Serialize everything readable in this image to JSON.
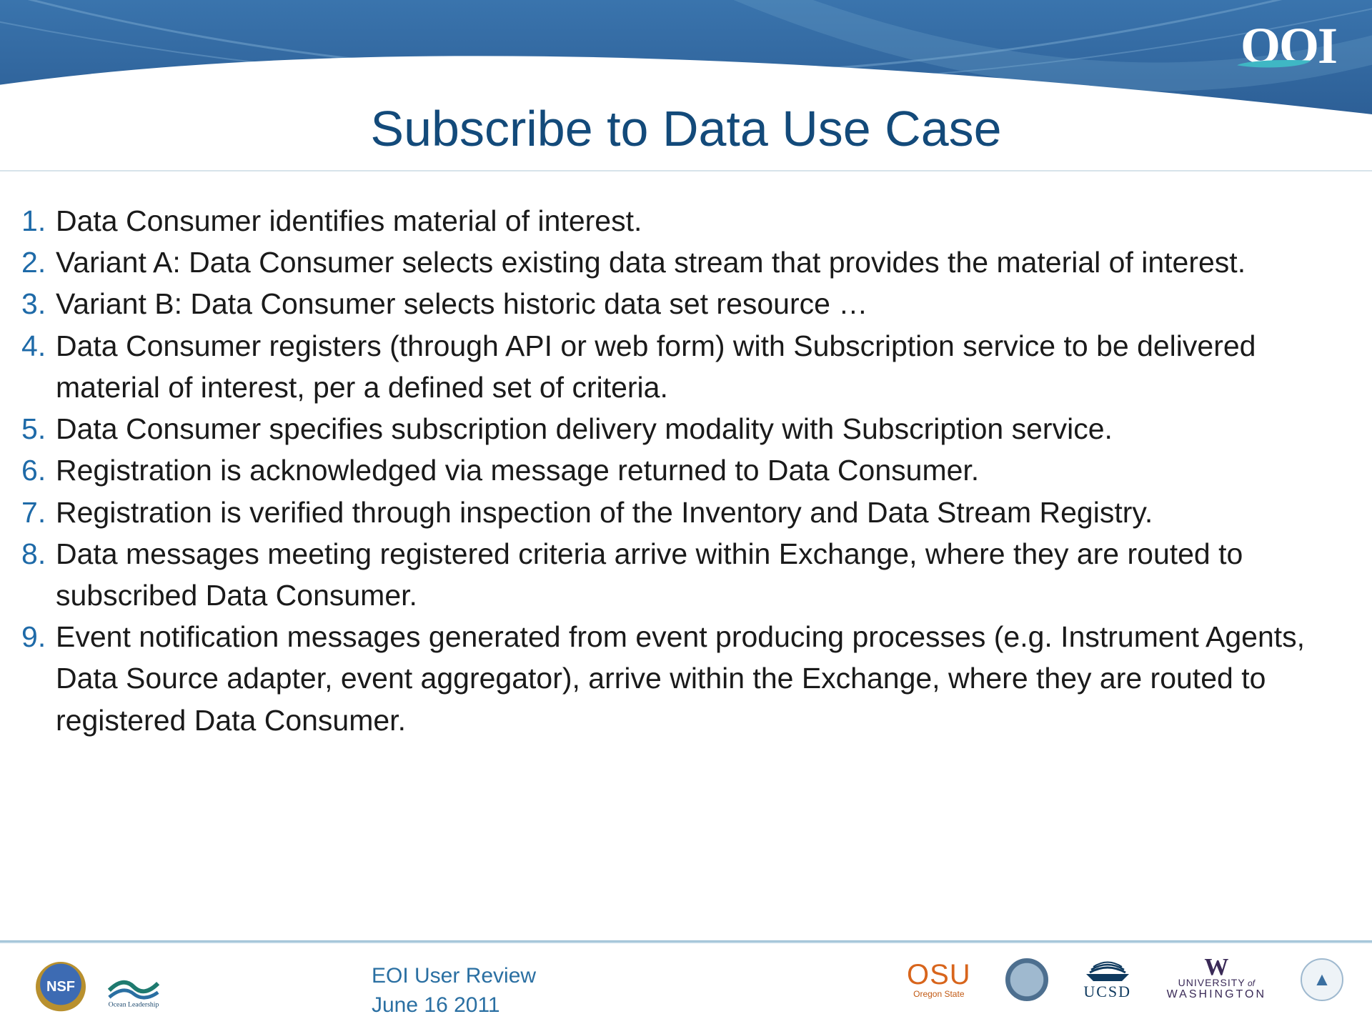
{
  "header": {
    "logo_text": "OOI"
  },
  "title": "Subscribe to Data Use Case",
  "steps": [
    "Data Consumer identifies material of interest.",
    "Variant A: Data Consumer selects existing data stream that provides the material of interest.",
    "Variant B: Data Consumer selects historic data set resource …",
    "Data Consumer registers (through API or web form) with Subscription service to be delivered material of interest, per a defined set of criteria.",
    "Data Consumer specifies subscription delivery modality with Subscription service.",
    "Registration is acknowledged via message returned to Data Consumer.",
    "Registration is verified through inspection of the Inventory and Data Stream Registry.",
    "Data messages meeting registered criteria arrive within Exchange, where they are routed to subscribed Data Consumer.",
    "Event notification messages generated from event producing processes (e.g. Instrument Agents, Data Source adapter, event aggregator), arrive within the Exchange, where they are routed to registered Data Consumer."
  ],
  "footer": {
    "line1": "EOI User Review",
    "line2": "June 16 2011",
    "logos": {
      "nsf": "NSF",
      "ocean": "Ocean Leadership",
      "osu": "OSU",
      "osu_sub": "Oregon State",
      "ucsd": "UCSD",
      "uw_w": "W",
      "uw_line1a": "UNIVERSITY",
      "uw_line1of": " of",
      "uw_line2": "WASHINGTON"
    }
  }
}
